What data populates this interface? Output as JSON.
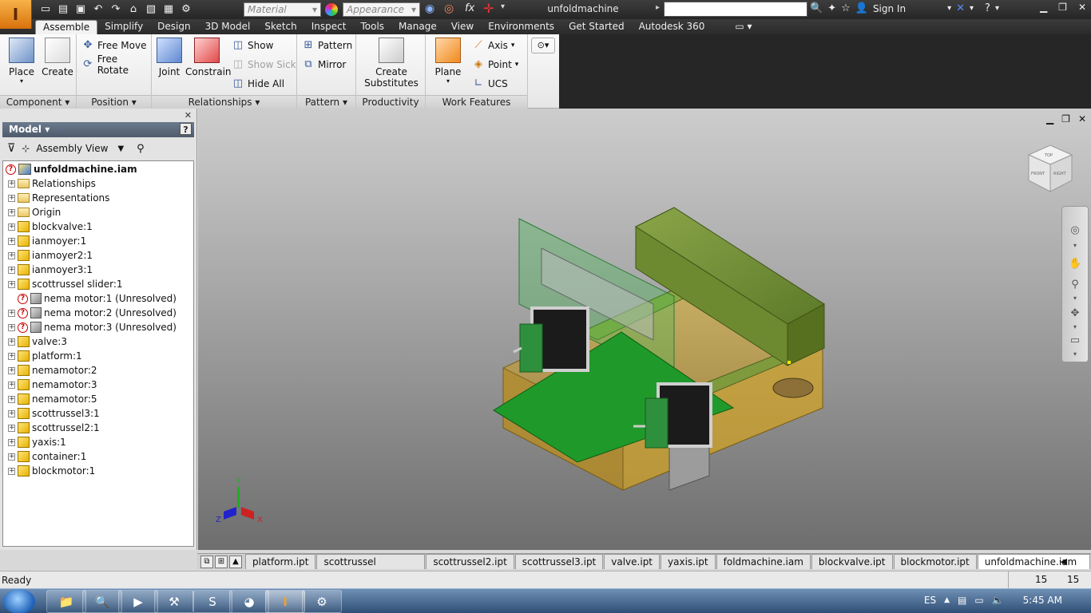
{
  "window": {
    "title": "unfoldmachine",
    "app_icon": "I",
    "material_placeholder": "Material",
    "appearance_placeholder": "Appearance",
    "sign_in": "Sign In"
  },
  "ribbon_tabs": [
    "Assemble",
    "Simplify",
    "Design",
    "3D Model",
    "Sketch",
    "Inspect",
    "Tools",
    "Manage",
    "View",
    "Environments",
    "Get Started",
    "Autodesk 360"
  ],
  "ribbon": {
    "place": "Place",
    "create": "Create",
    "free_move": "Free Move",
    "free_rotate": "Free Rotate",
    "joint": "Joint",
    "constrain": "Constrain",
    "show": "Show",
    "show_sick": "Show Sick",
    "hide_all": "Hide All",
    "pattern": "Pattern",
    "mirror": "Mirror",
    "create_substitutes_1": "Create",
    "create_substitutes_2": "Substitutes",
    "plane": "Plane",
    "axis": "Axis",
    "point": "Point",
    "ucs": "UCS",
    "panels": [
      "Component",
      "Position",
      "Relationships",
      "Pattern",
      "Productivity",
      "Work Features"
    ]
  },
  "browser": {
    "header": "Model",
    "help": "?",
    "view_mode": "Assembly View",
    "root": "unfoldmachine.iam",
    "nodes": [
      {
        "label": "Relationships",
        "icon": "folder-icon",
        "error": false
      },
      {
        "label": "Representations",
        "icon": "folder-icon",
        "error": false
      },
      {
        "label": "Origin",
        "icon": "folder-icon",
        "error": false
      },
      {
        "label": "blockvalve:1",
        "icon": "part-icon",
        "error": false
      },
      {
        "label": "ianmoyer:1",
        "icon": "part-icon",
        "error": false
      },
      {
        "label": "ianmoyer2:1",
        "icon": "part-icon",
        "error": false
      },
      {
        "label": "ianmoyer3:1",
        "icon": "part-icon",
        "error": false
      },
      {
        "label": "scottrussel slider:1",
        "icon": "part-icon",
        "error": false
      },
      {
        "label": "nema motor:1 (Unresolved)",
        "icon": "unresolved-icon",
        "error": true
      },
      {
        "label": "nema motor:2 (Unresolved)",
        "icon": "unresolved-icon",
        "error": true
      },
      {
        "label": "nema motor:3 (Unresolved)",
        "icon": "unresolved-icon",
        "error": true
      },
      {
        "label": "valve:3",
        "icon": "part-icon",
        "error": false
      },
      {
        "label": "platform:1",
        "icon": "part-icon",
        "error": false
      },
      {
        "label": "nemamotor:2",
        "icon": "part-icon",
        "error": false
      },
      {
        "label": "nemamotor:3",
        "icon": "part-icon",
        "error": false
      },
      {
        "label": "nemamotor:5",
        "icon": "part-icon",
        "error": false
      },
      {
        "label": "scottrussel3:1",
        "icon": "part-icon",
        "error": false
      },
      {
        "label": "scottrussel2:1",
        "icon": "part-icon",
        "error": false
      },
      {
        "label": "yaxis:1",
        "icon": "part-icon",
        "error": false
      },
      {
        "label": "container:1",
        "icon": "part-icon",
        "error": false
      },
      {
        "label": "blockmotor:1",
        "icon": "part-icon",
        "error": false
      }
    ]
  },
  "triad": {
    "x": "X",
    "y": "Y",
    "z": "Z"
  },
  "viewcube": {
    "front": "FRONT",
    "right": "RIGHT",
    "top": "TOP"
  },
  "document_tabs": [
    "platform.ipt",
    "scottrussel slider.ipt",
    "scottrussel2.ipt",
    "scottrussel3.ipt",
    "valve.ipt",
    "yaxis.ipt",
    "foldmachine.iam",
    "blockvalve.ipt",
    "blockmotor.ipt",
    "unfoldmachine.iam"
  ],
  "active_document": "unfoldmachine.iam",
  "status": {
    "text": "Ready",
    "count1": "15",
    "count2": "15"
  },
  "taskbar": {
    "language": "ES",
    "time": "5:45 AM"
  },
  "colors": {
    "app_orange": "#f0a030",
    "part_green": "#6b8a32",
    "board_green": "#1f9a2a",
    "frame_gold": "#c9a23a"
  }
}
